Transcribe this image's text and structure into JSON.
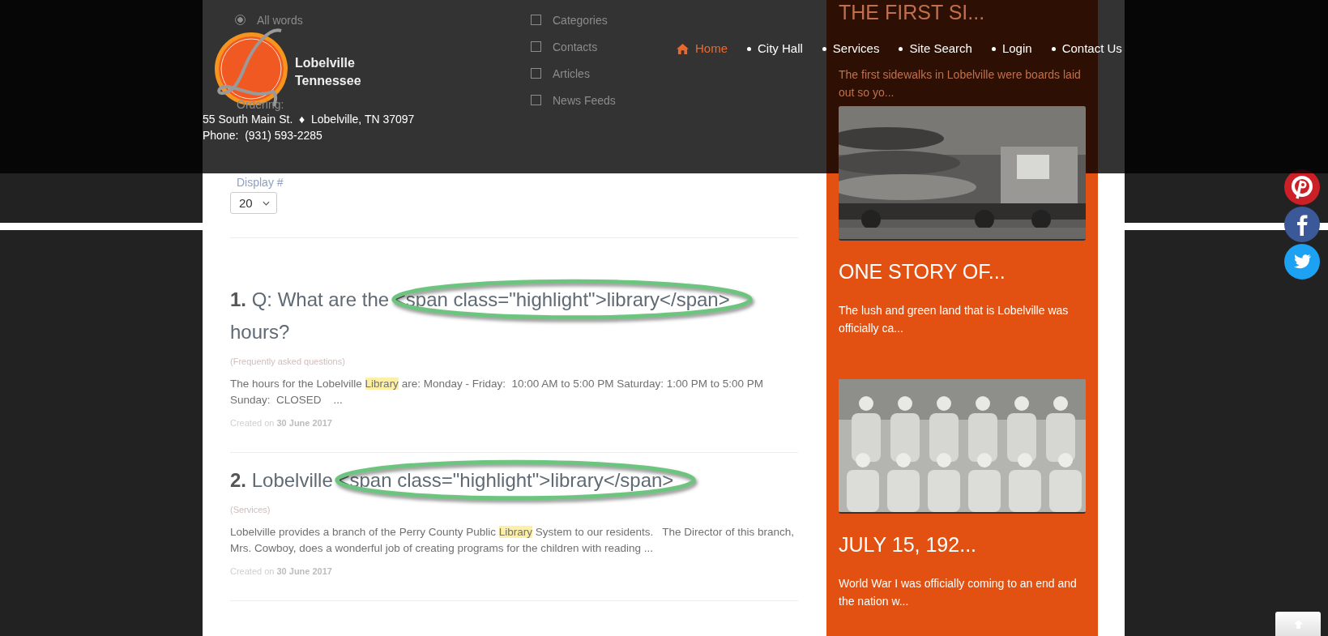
{
  "header": {
    "logo_lines": [
      "Lobelville",
      "Tennessee"
    ],
    "address": "55 South Main St.  ♦  Lobelville, TN 37097",
    "phone": "Phone:  (931) 593-2285",
    "nav": [
      {
        "label": "Home",
        "kind": "home",
        "selected": true
      },
      {
        "label": "City Hall",
        "kind": "page",
        "selected": false
      },
      {
        "label": "Services",
        "kind": "page",
        "selected": false
      },
      {
        "label": "Site Search",
        "kind": "page",
        "selected": false
      },
      {
        "label": "Login",
        "kind": "page",
        "selected": false
      },
      {
        "label": "Contact Us",
        "kind": "page",
        "selected": false
      }
    ]
  },
  "search_options": {
    "match": [
      {
        "label": "All words",
        "selected": true
      }
    ],
    "ordering_label": "Ordering:",
    "areas": [
      {
        "label": "Categories",
        "checked": false
      },
      {
        "label": "Contacts",
        "checked": false
      },
      {
        "label": "Articles",
        "checked": false
      },
      {
        "label": "News Feeds",
        "checked": false
      }
    ]
  },
  "display": {
    "label": "Display #",
    "value": "20"
  },
  "results": [
    {
      "number": "1.",
      "title_before": "Q: What are the",
      "title_circled": "<span class=\"highlight\">library</span>",
      "title_after": "hours?",
      "category": "(Frequently asked questions)",
      "snippet_before": "The hours for the Lobelville ",
      "snippet_match": "Library",
      "snippet_after": " are: Monday - Friday:  10:00 AM to 5:00 PM Saturday: 1:00 PM to 5:00 PM Sunday:  CLOSED    ...",
      "created_label": "Created on",
      "created_date": "30 June 2017"
    },
    {
      "number": "2.",
      "title_before": "Lobelville",
      "title_circled": "<span class=\"highlight\">library</span>",
      "category": "(Services)",
      "snippet_before": "Lobelville provides a branch of the Perry County Public ",
      "snippet_match": "Library",
      "snippet_after": " System to our residents.   The Director of this branch, Mrs. Cowboy, does a wonderful job of creating programs for the children with reading ...",
      "created_label": "Created on",
      "created_date": "30 June 2017"
    }
  ],
  "sidebar": [
    {
      "title": "THE FIRST SI...",
      "excerpt": "The first sidewalks in Lobelville were boards laid out so yo..."
    },
    {
      "title": "ONE STORY OF...",
      "excerpt": "The lush and green land that is Lobelville was officially ca..."
    },
    {
      "title": "JULY 15, 192...",
      "excerpt": "World War I was officially coming to an end and the nation w..."
    }
  ]
}
